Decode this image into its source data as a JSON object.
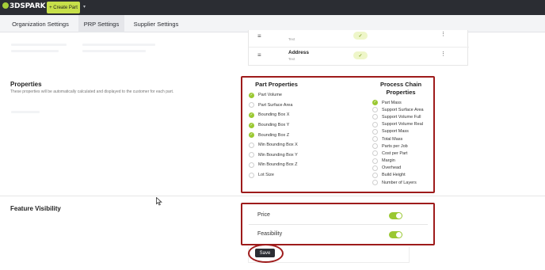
{
  "topbar": {
    "logo": "3DSPARK",
    "create_button": "+ Create Part",
    "caret": "▾"
  },
  "tabs": [
    {
      "label": "Organization Settings"
    },
    {
      "label": "PRP Settings"
    },
    {
      "label": "Supplier Settings"
    }
  ],
  "properties_table": {
    "rows": [
      {
        "name": "",
        "sub": "Text"
      },
      {
        "name": "Address",
        "sub": "Text"
      }
    ]
  },
  "properties": {
    "title": "Properties",
    "description": "These properties will be automatically calculated and displayed to the customer for each part.",
    "part_properties": {
      "title": "Part Properties",
      "items": [
        {
          "label": "Part Volume",
          "checked": true
        },
        {
          "label": "Part Surface Area",
          "checked": false
        },
        {
          "label": "Bounding Box X",
          "checked": true
        },
        {
          "label": "Bounding Box Y",
          "checked": true
        },
        {
          "label": "Bounding Box Z",
          "checked": true
        },
        {
          "label": "Min Bounding Box X",
          "checked": false
        },
        {
          "label": "Min Bounding Box Y",
          "checked": false
        },
        {
          "label": "Min Bounding Box Z",
          "checked": false
        },
        {
          "label": "Lot Size",
          "checked": false
        }
      ]
    },
    "process_chain": {
      "title_line1": "Process Chain",
      "title_line2": "Properties",
      "items": [
        {
          "label": "Part Mass",
          "checked": true
        },
        {
          "label": "Support Surface Area",
          "checked": false
        },
        {
          "label": "Support Volume Full",
          "checked": false
        },
        {
          "label": "Support Volume Real",
          "checked": false
        },
        {
          "label": "Support Mass",
          "checked": false
        },
        {
          "label": "Total Mass",
          "checked": false
        },
        {
          "label": "Parts per Job",
          "checked": false
        },
        {
          "label": "Cost per Part",
          "checked": false
        },
        {
          "label": "Margin",
          "checked": false
        },
        {
          "label": "Overhead",
          "checked": false
        },
        {
          "label": "Build Height",
          "checked": false
        },
        {
          "label": "Number of Layers",
          "checked": false
        }
      ]
    }
  },
  "feature_visibility": {
    "title": "Feature Visibility",
    "items": [
      {
        "label": "Price",
        "enabled": true
      },
      {
        "label": "Feasibility",
        "enabled": true
      }
    ]
  },
  "save_button": "Save",
  "colors": {
    "accent_green": "#9ac832",
    "highlight_red": "#9e1b1b",
    "topbar": "#2b2d33"
  }
}
